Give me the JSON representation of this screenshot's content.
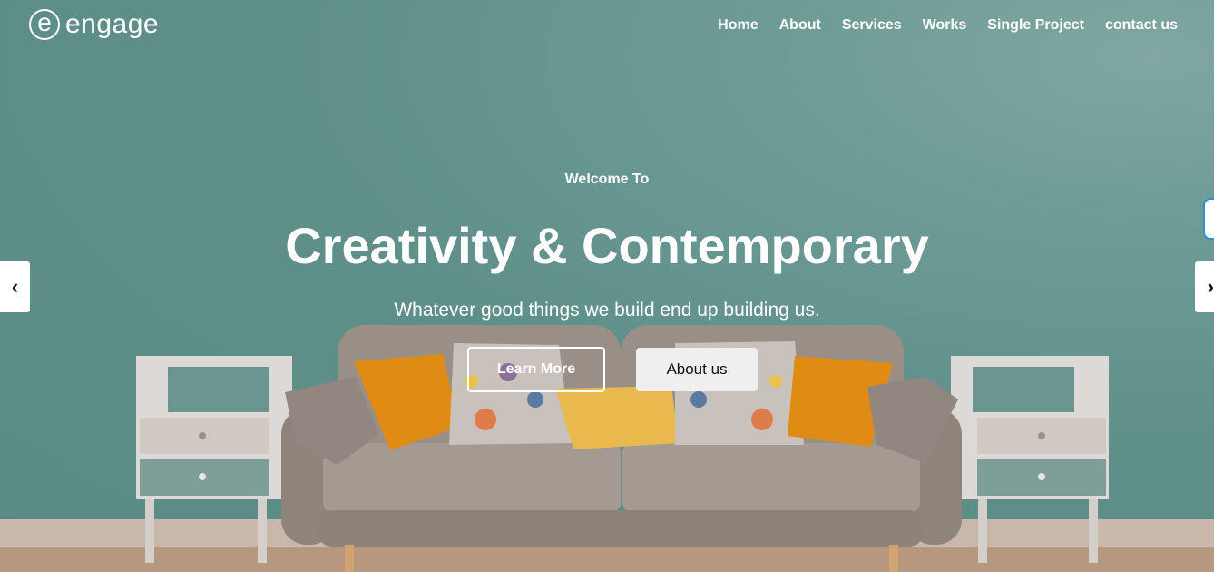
{
  "brand": {
    "logo_letter": "e",
    "name": "engage"
  },
  "nav": {
    "items": [
      "Home",
      "About",
      "Services",
      "Works",
      "Single Project",
      "contact us"
    ]
  },
  "hero": {
    "eyebrow": "Welcome To",
    "title": "Creativity & Contemporary",
    "subtitle": "Whatever good things we build end up building us.",
    "primary_button": "Learn More",
    "secondary_button": "About us"
  },
  "slider": {
    "prev_glyph": "‹",
    "next_glyph": "›"
  },
  "colors": {
    "wall": "#5f8f89",
    "sofa": "#9c918a",
    "cushion_orange": "#e08b14",
    "cushion_yellow": "#e9b94d",
    "floor": "#b7987e"
  }
}
